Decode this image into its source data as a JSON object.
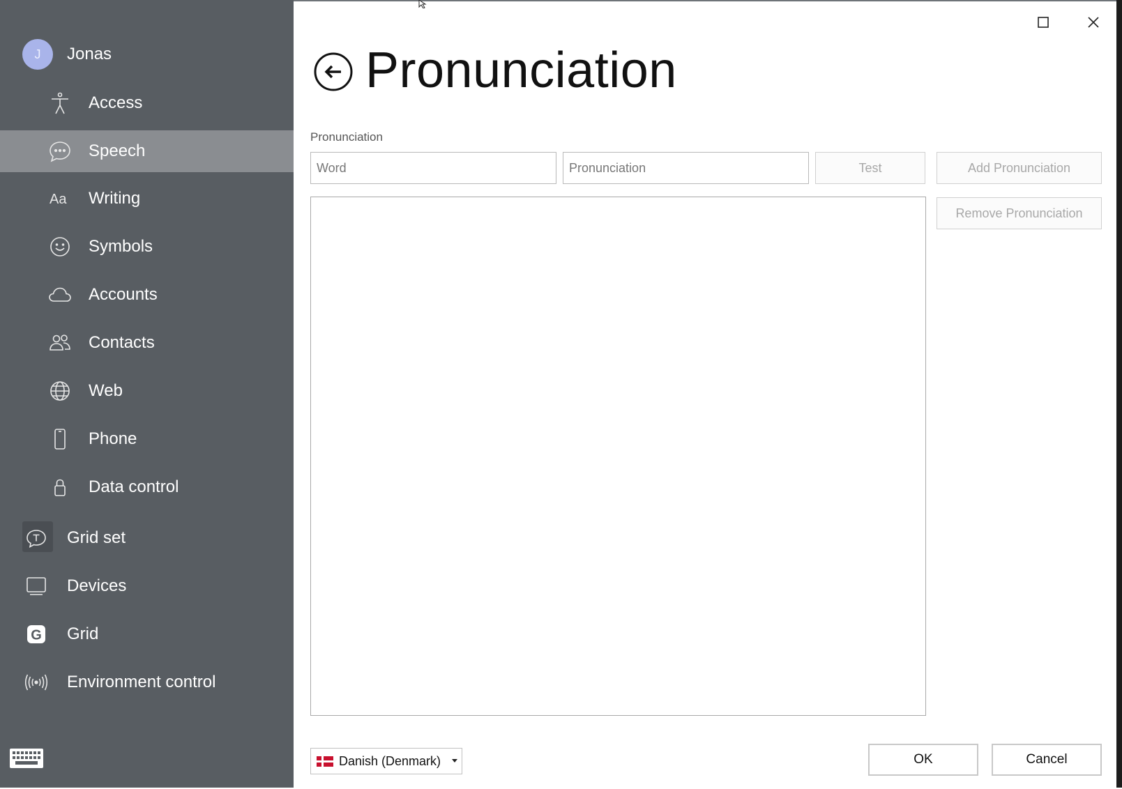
{
  "user": {
    "initial": "J",
    "name": "Jonas"
  },
  "sidebar": {
    "sub_items": [
      {
        "label": "Access",
        "icon": "accessibility-icon"
      },
      {
        "label": "Speech",
        "icon": "speech-bubble-icon",
        "active": true
      },
      {
        "label": "Writing",
        "icon": "text-aa-icon"
      },
      {
        "label": "Symbols",
        "icon": "smiley-icon"
      },
      {
        "label": "Accounts",
        "icon": "cloud-icon"
      },
      {
        "label": "Contacts",
        "icon": "people-icon"
      },
      {
        "label": "Web",
        "icon": "globe-icon"
      },
      {
        "label": "Phone",
        "icon": "phone-icon"
      },
      {
        "label": "Data control",
        "icon": "lock-icon"
      }
    ],
    "top_items": [
      {
        "label": "Grid set",
        "icon": "gridset-icon"
      },
      {
        "label": "Devices",
        "icon": "monitor-icon"
      },
      {
        "label": "Grid",
        "icon": "grid-logo-icon"
      },
      {
        "label": "Environment control",
        "icon": "broadcast-icon"
      }
    ]
  },
  "header": {
    "title": "Pronunciation"
  },
  "form": {
    "section_label": "Pronunciation",
    "word_placeholder": "Word",
    "pronunciation_placeholder": "Pronunciation",
    "test_label": "Test",
    "add_label": "Add Pronunciation",
    "remove_label": "Remove Pronunciation"
  },
  "footer": {
    "language": "Danish (Denmark)",
    "ok_label": "OK",
    "cancel_label": "Cancel"
  },
  "colors": {
    "sidebar": "#585d62",
    "active": "#8a8d91",
    "avatar": "#a9b4ea"
  }
}
